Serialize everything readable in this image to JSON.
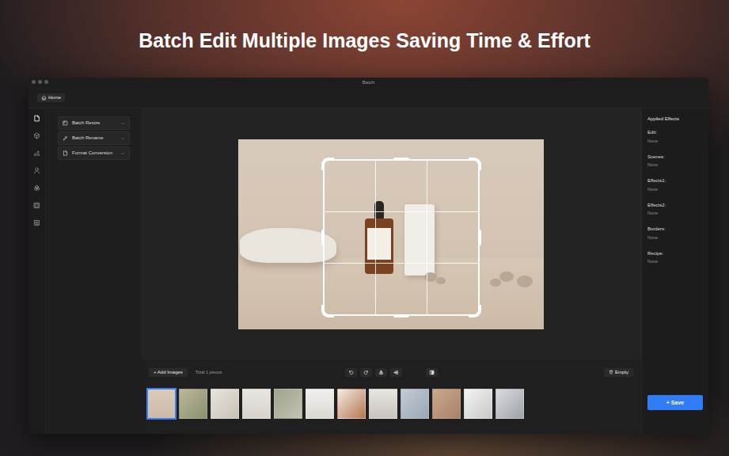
{
  "headline": "Batch Edit Multiple Images Saving Time & Effort",
  "window": {
    "title": "Batch"
  },
  "toolbar": {
    "home": "Home"
  },
  "sidebar": {
    "icons": [
      {
        "selected": true
      },
      {
        "selected": false
      },
      {
        "selected": false
      },
      {
        "selected": false
      },
      {
        "selected": false
      },
      {
        "selected": false
      },
      {
        "selected": false
      }
    ]
  },
  "tools": [
    {
      "label": "Batch Resize"
    },
    {
      "label": "Batch Rename"
    },
    {
      "label": "Format Conversion"
    }
  ],
  "effects": {
    "title": "Applied Effects",
    "items": [
      {
        "label": "Edit:",
        "value": "None"
      },
      {
        "label": "Scenes:",
        "value": "None"
      },
      {
        "label": "Effects1:",
        "value": "None"
      },
      {
        "label": "Effects2:",
        "value": "None"
      },
      {
        "label": "Borders:",
        "value": "None"
      },
      {
        "label": "Recipe:",
        "value": "None"
      }
    ]
  },
  "controls": {
    "add_images": "+ Add Images",
    "total": "Total 1 pieces",
    "empty": "Empty"
  },
  "thumbnails": [
    {
      "selected": true
    },
    {
      "selected": false
    },
    {
      "selected": false
    },
    {
      "selected": false
    },
    {
      "selected": false
    },
    {
      "selected": false
    },
    {
      "selected": false
    },
    {
      "selected": false
    },
    {
      "selected": false
    },
    {
      "selected": false
    },
    {
      "selected": false
    },
    {
      "selected": false
    }
  ],
  "save": "+ Save"
}
